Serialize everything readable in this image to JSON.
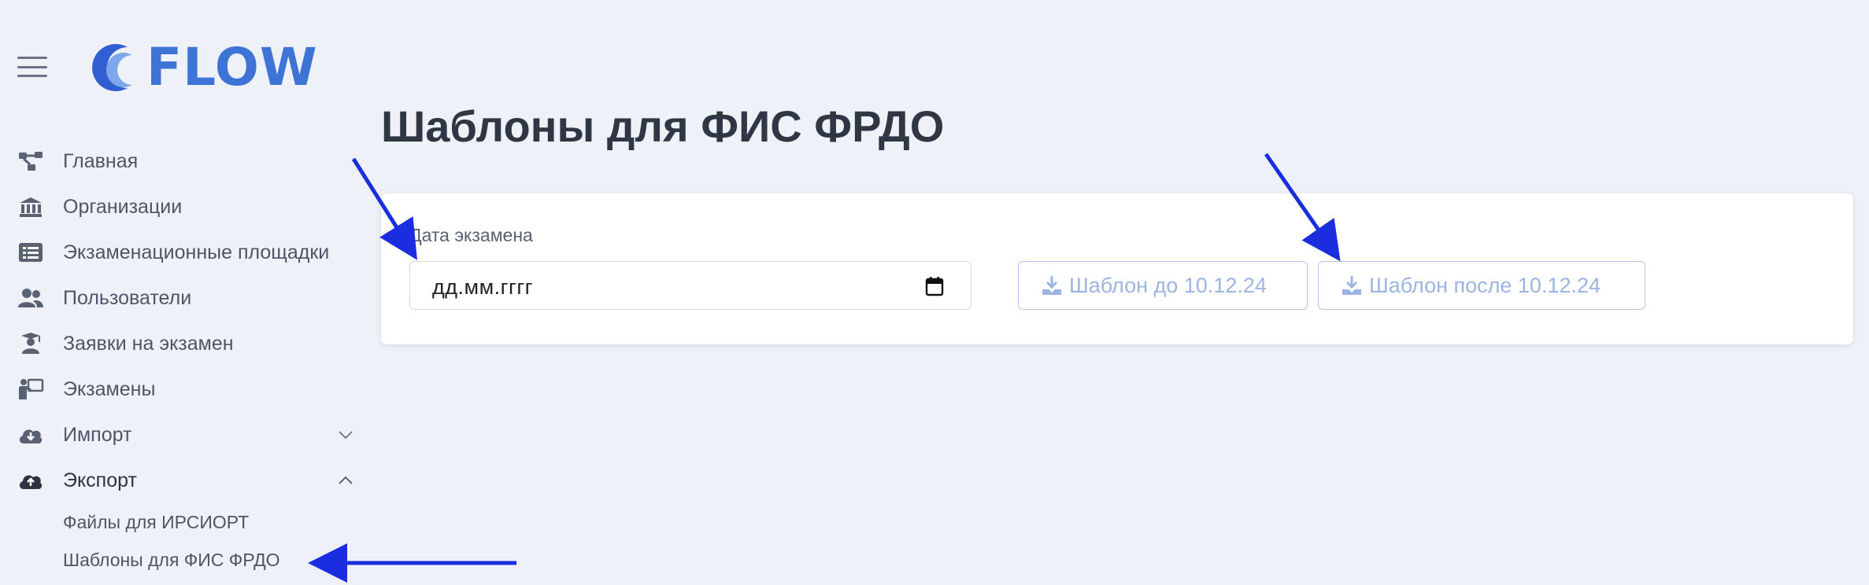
{
  "brand": {
    "name": "FLOW"
  },
  "sidebar": {
    "items": [
      {
        "label": "Главная",
        "icon": "diagram-icon"
      },
      {
        "label": "Организации",
        "icon": "institution-icon"
      },
      {
        "label": "Экзаменационные площадки",
        "icon": "list-icon"
      },
      {
        "label": "Пользователи",
        "icon": "users-icon"
      },
      {
        "label": "Заявки на экзамен",
        "icon": "graduate-icon"
      },
      {
        "label": "Экзамены",
        "icon": "teacher-icon"
      },
      {
        "label": "Импорт",
        "icon": "cloud-download-icon",
        "expanded": false
      },
      {
        "label": "Экспорт",
        "icon": "cloud-upload-icon",
        "expanded": true
      }
    ],
    "export_subitems": [
      {
        "label": "Файлы для ИРСИОРТ"
      },
      {
        "label": "Шаблоны для ФИС ФРДО",
        "active": true
      }
    ]
  },
  "main": {
    "title": "Шаблоны для ФИС ФРДО",
    "form": {
      "date_label": "Дата экзамена",
      "date_value": "дд.мм.гггг",
      "button_before": "Шаблон до 10.12.24",
      "button_after": "Шаблон после 10.12.24"
    }
  },
  "colors": {
    "background": "#eef1f8",
    "brand_blue": "#3e74d6",
    "button_disabled_text": "#9bb4e2",
    "annotation_arrow": "#1a2ee0"
  }
}
